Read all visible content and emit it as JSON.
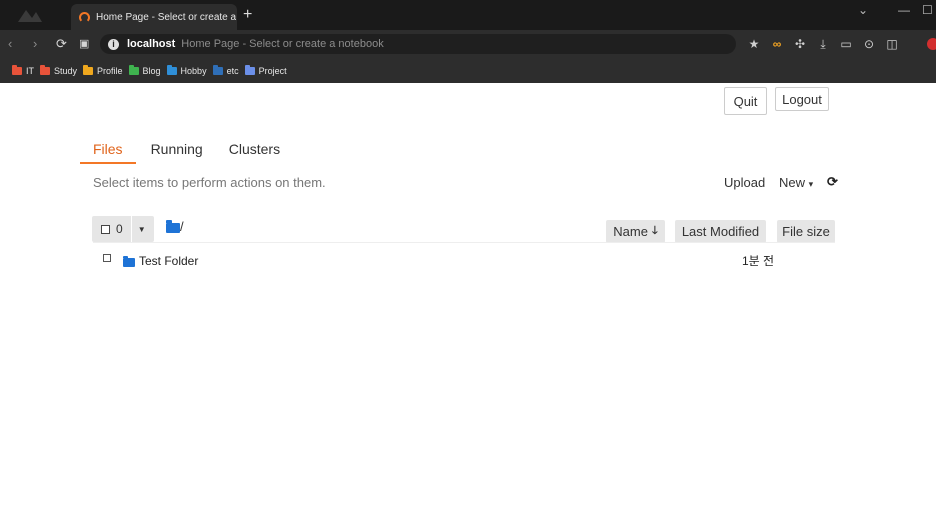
{
  "browser": {
    "tab_title": "Home Page - Select or create a notebook",
    "url_host": "localhost",
    "url_page": "Home Page - Select or create a notebook",
    "bookmarks": [
      {
        "label": "IT",
        "color": "#e8533a"
      },
      {
        "label": "Study",
        "color": "#e8533a"
      },
      {
        "label": "Profile",
        "color": "#f0a81e"
      },
      {
        "label": "Blog",
        "color": "#3fb34f"
      },
      {
        "label": "Hobby",
        "color": "#2f8fd8"
      },
      {
        "label": "etc",
        "color": "#2f6fb8"
      },
      {
        "label": "Project",
        "color": "#6b8fe8"
      }
    ]
  },
  "header": {
    "quit_label": "Quit",
    "logout_label": "Logout"
  },
  "tabs": [
    {
      "label": "Files",
      "active": true
    },
    {
      "label": "Running",
      "active": false
    },
    {
      "label": "Clusters",
      "active": false
    }
  ],
  "toolbar": {
    "hint": "Select items to perform actions on them.",
    "upload_label": "Upload",
    "new_label": "New"
  },
  "list": {
    "selected_count": "0",
    "breadcrumb": "/",
    "columns": {
      "name": "Name",
      "last_modified": "Last Modified",
      "file_size": "File size"
    },
    "rows": [
      {
        "name": "Test Folder",
        "last_modified": "1분 전",
        "type": "folder"
      }
    ]
  },
  "colors": {
    "accent": "#f37726",
    "folder": "#1e73d6"
  }
}
